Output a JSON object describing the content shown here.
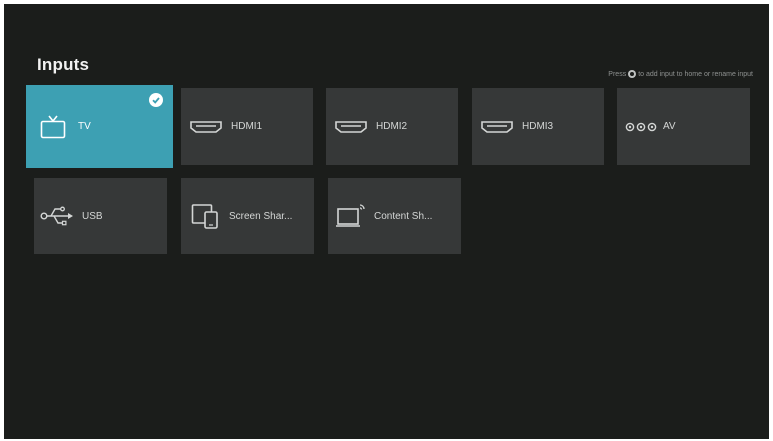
{
  "page": {
    "title": "Inputs"
  },
  "hint": {
    "prefix": "Press",
    "suffix": "to add input to home or rename input"
  },
  "inputs": [
    {
      "label": "TV",
      "icon": "tv-icon",
      "selected": true
    },
    {
      "label": "HDMI1",
      "icon": "hdmi-icon"
    },
    {
      "label": "HDMI2",
      "icon": "hdmi-icon"
    },
    {
      "label": "HDMI3",
      "icon": "hdmi-icon"
    },
    {
      "label": "AV",
      "icon": "av-icon"
    },
    {
      "label": "USB",
      "icon": "usb-icon"
    },
    {
      "label": "Screen Shar...",
      "icon": "screen-share-icon"
    },
    {
      "label": "Content Sh...",
      "icon": "content-share-icon"
    }
  ],
  "colors": {
    "background": "#1b1d1b",
    "tile": "#363838",
    "selected_tile": "#3da0b3",
    "text": "#d4d6d5"
  }
}
